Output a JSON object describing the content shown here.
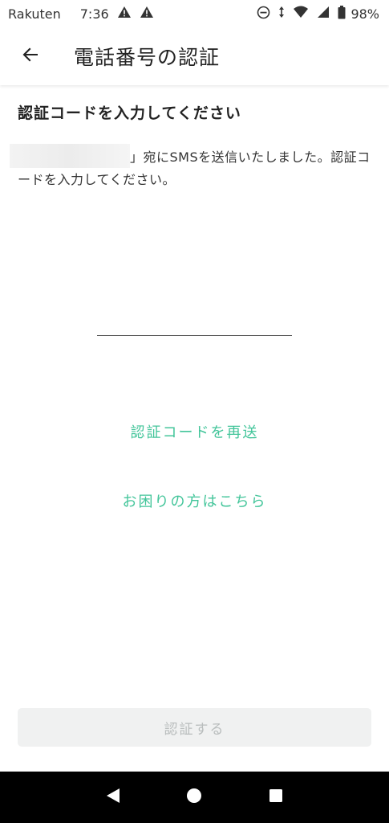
{
  "status_bar": {
    "carrier": "Rakuten",
    "time": "7:36",
    "battery": "98%",
    "icons": [
      "warning-icon",
      "warning-icon",
      "do-not-disturb-icon",
      "data-arrows-icon",
      "wifi-icon",
      "signal-icon",
      "battery-icon"
    ]
  },
  "app_bar": {
    "back_icon": "arrow-left-icon",
    "title": "電話番号の認証"
  },
  "main": {
    "heading": "認証コードを入力してください",
    "message": "」宛にSMSを送信いたしました。認証コードを入力してください。",
    "code_input": {
      "value": "",
      "placeholder": ""
    },
    "resend_link": "認証コードを再送",
    "help_link": "お困りの方はこちら",
    "submit_label": "認証する"
  },
  "colors": {
    "accent": "#43c59a",
    "disabled_button_bg": "#f0f1f1",
    "disabled_button_text": "#b9bdbd",
    "nav_bar": "#000000"
  },
  "nav_bar": {
    "icons": [
      "back-triangle-icon",
      "home-circle-icon",
      "recents-square-icon"
    ]
  }
}
